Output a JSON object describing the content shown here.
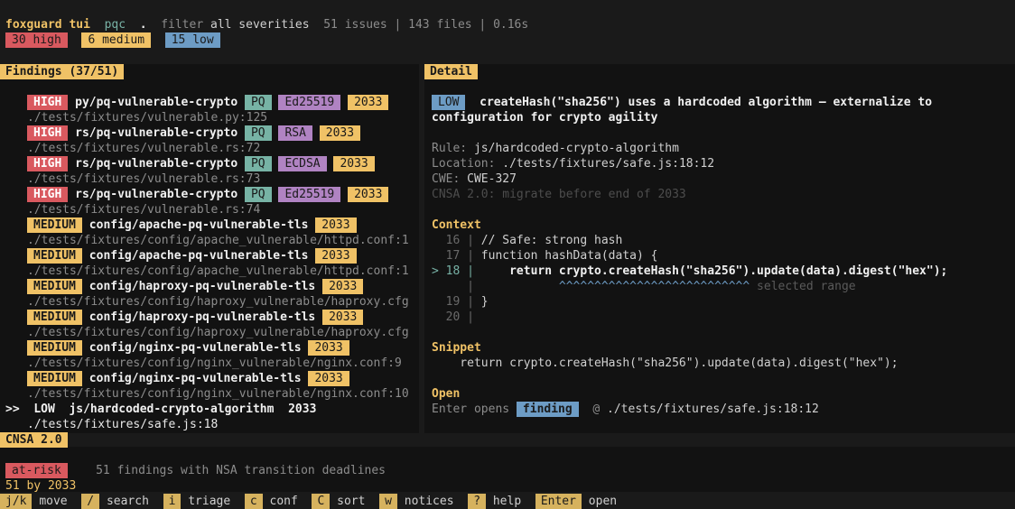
{
  "header": {
    "app": "foxguard tui",
    "mode": "pqc",
    "dot": ".",
    "filter_label": "filter",
    "filter_value": "all severities",
    "stats": "51 issues | 143 files | 0.16s",
    "badges": {
      "high": "30 high",
      "medium": "6 medium",
      "low": "15 low"
    }
  },
  "findings": {
    "title": "Findings (37/51)",
    "items": [
      {
        "sev": "HIGH",
        "rule": "py/pq-vulnerable-crypto",
        "pq": "PQ",
        "alg": "Ed25519",
        "year": "2033",
        "path": "./tests/fixtures/vulnerable.py:125"
      },
      {
        "sev": "HIGH",
        "rule": "rs/pq-vulnerable-crypto",
        "pq": "PQ",
        "alg": "RSA",
        "year": "2033",
        "path": "./tests/fixtures/vulnerable.rs:72"
      },
      {
        "sev": "HIGH",
        "rule": "rs/pq-vulnerable-crypto",
        "pq": "PQ",
        "alg": "ECDSA",
        "year": "2033",
        "path": "./tests/fixtures/vulnerable.rs:73"
      },
      {
        "sev": "HIGH",
        "rule": "rs/pq-vulnerable-crypto",
        "pq": "PQ",
        "alg": "Ed25519",
        "year": "2033",
        "path": "./tests/fixtures/vulnerable.rs:74"
      },
      {
        "sev": "MEDIUM",
        "rule": "config/apache-pq-vulnerable-tls",
        "year": "2033",
        "path": "./tests/fixtures/config/apache_vulnerable/httpd.conf:1"
      },
      {
        "sev": "MEDIUM",
        "rule": "config/apache-pq-vulnerable-tls",
        "year": "2033",
        "path": "./tests/fixtures/config/apache_vulnerable/httpd.conf:1"
      },
      {
        "sev": "MEDIUM",
        "rule": "config/haproxy-pq-vulnerable-tls",
        "year": "2033",
        "path": "./tests/fixtures/config/haproxy_vulnerable/haproxy.cfg"
      },
      {
        "sev": "MEDIUM",
        "rule": "config/haproxy-pq-vulnerable-tls",
        "year": "2033",
        "path": "./tests/fixtures/config/haproxy_vulnerable/haproxy.cfg"
      },
      {
        "sev": "MEDIUM",
        "rule": "config/nginx-pq-vulnerable-tls",
        "year": "2033",
        "path": "./tests/fixtures/config/nginx_vulnerable/nginx.conf:9"
      },
      {
        "sev": "MEDIUM",
        "rule": "config/nginx-pq-vulnerable-tls",
        "year": "2033",
        "path": "./tests/fixtures/config/nginx_vulnerable/nginx.conf:10"
      }
    ],
    "selected": {
      "marker": ">>",
      "sev": "LOW",
      "rule": "js/hardcoded-crypto-algorithm",
      "year": "2033",
      "path": "./tests/fixtures/safe.js:18"
    }
  },
  "detail": {
    "title": "Detail",
    "severity": "LOW",
    "message_1": "createHash(\"sha256\") uses a hardcoded algorithm — externalize to",
    "message_2": "configuration for crypto agility",
    "rule_label": "Rule:",
    "rule_value": "js/hardcoded-crypto-algorithm",
    "location_label": "Location:",
    "location_value": "./tests/fixtures/safe.js:18:12",
    "cwe_label": "CWE:",
    "cwe_value": "CWE-327",
    "cnsa_note": "CNSA 2.0: migrate before end of 2033",
    "context_title": "Context",
    "context_lines": [
      {
        "gutter": "  16 | ",
        "code": "// Safe: strong hash"
      },
      {
        "gutter": "  17 | ",
        "code": "function hashData(data) {"
      },
      {
        "gutter": "> 18 | ",
        "code": "    return crypto.createHash(\"sha256\").update(data).digest(\"hex\");"
      },
      {
        "gutter": "     | ",
        "code": "           ^^^^^^^^^^^^^^^^^^^^^^^^^^^",
        "note": " selected range"
      },
      {
        "gutter": "  19 | ",
        "code": "}"
      },
      {
        "gutter": "  20 | ",
        "code": ""
      }
    ],
    "snippet_title": "Snippet",
    "snippet_code": "    return crypto.createHash(\"sha256\").update(data).digest(\"hex\");",
    "open_title": "Open",
    "open_prefix": "Enter opens",
    "open_target": "finding",
    "open_at": "@",
    "open_path": "./tests/fixtures/safe.js:18:12"
  },
  "cnsa": {
    "title": "CNSA 2.0",
    "status": "at-risk",
    "summary": "51 findings with NSA transition deadlines",
    "count": "51 by 2033"
  },
  "footer": {
    "keys": [
      {
        "key": "j/k",
        "label": "move"
      },
      {
        "key": "/",
        "label": "search"
      },
      {
        "key": "i",
        "label": "triage"
      },
      {
        "key": "c",
        "label": "conf"
      },
      {
        "key": "C",
        "label": "sort"
      },
      {
        "key": "w",
        "label": "notices"
      },
      {
        "key": "?",
        "label": "help"
      },
      {
        "key": "Enter",
        "label": "open"
      }
    ]
  },
  "colors": {
    "high": "#d9595f",
    "medium": "#f0c266",
    "low": "#6d9cc5",
    "pq": "#77b3a5",
    "alg": "#b083c2",
    "accent": "#f0c266"
  }
}
